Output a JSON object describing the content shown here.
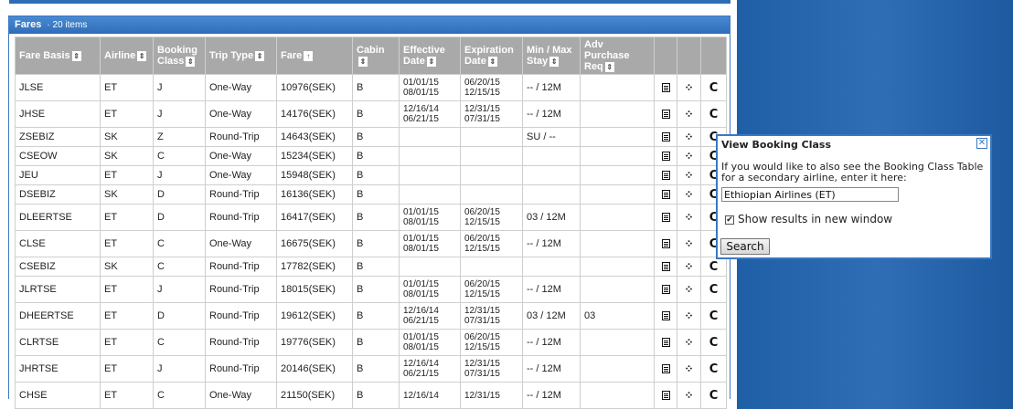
{
  "panel": {
    "title": "Fares",
    "count": "· 20 items"
  },
  "columns": [
    {
      "key": "fare_basis",
      "line1": "Fare Basis",
      "line2": "",
      "sort": "⇕"
    },
    {
      "key": "airline",
      "line1": "Airline",
      "line2": "",
      "sort": "⇕"
    },
    {
      "key": "booking_class",
      "line1": "Booking",
      "line2": "Class",
      "sort": "⇕"
    },
    {
      "key": "trip_type",
      "line1": "Trip Type",
      "line2": "",
      "sort": "⇕"
    },
    {
      "key": "fare",
      "line1": "Fare",
      "line2": "",
      "sort": "↑"
    },
    {
      "key": "cabin",
      "line1": "Cabin",
      "line2": "",
      "sort": "⇕"
    },
    {
      "key": "effective_date",
      "line1": "Effective",
      "line2": "Date",
      "sort": "⇕"
    },
    {
      "key": "expiration_date",
      "line1": "Expiration",
      "line2": "Date",
      "sort": "⇕"
    },
    {
      "key": "min_max_stay",
      "line1": "Min / Max",
      "line2": "Stay",
      "sort": "⇕"
    },
    {
      "key": "adv_purchase",
      "line1": "Adv Purchase",
      "line2": "Req",
      "sort": "⇕"
    }
  ],
  "row_icons": {
    "rules": "rules-icon",
    "route": "route-map-icon",
    "class": "booking-class-icon",
    "class_glyph": "C"
  },
  "rows": [
    {
      "fare_basis": "JLSE",
      "airline": "ET",
      "booking_class": "J",
      "trip_type": "One-Way",
      "fare": "10976(SEK)",
      "cabin": "B",
      "eff1": "01/01/15",
      "eff2": "08/01/15",
      "exp1": "06/20/15",
      "exp2": "12/15/15",
      "stay": "-- / 12M",
      "adv": ""
    },
    {
      "fare_basis": "JHSE",
      "airline": "ET",
      "booking_class": "J",
      "trip_type": "One-Way",
      "fare": "14176(SEK)",
      "cabin": "B",
      "eff1": "12/16/14",
      "eff2": "06/21/15",
      "exp1": "12/31/15",
      "exp2": "07/31/15",
      "stay": "-- / 12M",
      "adv": ""
    },
    {
      "fare_basis": "ZSEBIZ",
      "airline": "SK",
      "booking_class": "Z",
      "trip_type": "Round-Trip",
      "fare": "14643(SEK)",
      "cabin": "B",
      "eff1": "",
      "eff2": "",
      "exp1": "",
      "exp2": "",
      "stay": "SU / --",
      "adv": ""
    },
    {
      "fare_basis": "CSEOW",
      "airline": "SK",
      "booking_class": "C",
      "trip_type": "One-Way",
      "fare": "15234(SEK)",
      "cabin": "B",
      "eff1": "",
      "eff2": "",
      "exp1": "",
      "exp2": "",
      "stay": "",
      "adv": ""
    },
    {
      "fare_basis": "JEU",
      "airline": "ET",
      "booking_class": "J",
      "trip_type": "One-Way",
      "fare": "15948(SEK)",
      "cabin": "B",
      "eff1": "",
      "eff2": "",
      "exp1": "",
      "exp2": "",
      "stay": "",
      "adv": ""
    },
    {
      "fare_basis": "DSEBIZ",
      "airline": "SK",
      "booking_class": "D",
      "trip_type": "Round-Trip",
      "fare": "16136(SEK)",
      "cabin": "B",
      "eff1": "",
      "eff2": "",
      "exp1": "",
      "exp2": "",
      "stay": "",
      "adv": ""
    },
    {
      "fare_basis": "DLEERTSE",
      "airline": "ET",
      "booking_class": "D",
      "trip_type": "Round-Trip",
      "fare": "16417(SEK)",
      "cabin": "B",
      "eff1": "01/01/15",
      "eff2": "08/01/15",
      "exp1": "06/20/15",
      "exp2": "12/15/15",
      "stay": "03 / 12M",
      "adv": ""
    },
    {
      "fare_basis": "CLSE",
      "airline": "ET",
      "booking_class": "C",
      "trip_type": "One-Way",
      "fare": "16675(SEK)",
      "cabin": "B",
      "eff1": "01/01/15",
      "eff2": "08/01/15",
      "exp1": "06/20/15",
      "exp2": "12/15/15",
      "stay": "-- / 12M",
      "adv": ""
    },
    {
      "fare_basis": "CSEBIZ",
      "airline": "SK",
      "booking_class": "C",
      "trip_type": "Round-Trip",
      "fare": "17782(SEK)",
      "cabin": "B",
      "eff1": "",
      "eff2": "",
      "exp1": "",
      "exp2": "",
      "stay": "",
      "adv": ""
    },
    {
      "fare_basis": "JLRTSE",
      "airline": "ET",
      "booking_class": "J",
      "trip_type": "Round-Trip",
      "fare": "18015(SEK)",
      "cabin": "B",
      "eff1": "01/01/15",
      "eff2": "08/01/15",
      "exp1": "06/20/15",
      "exp2": "12/15/15",
      "stay": "-- / 12M",
      "adv": ""
    },
    {
      "fare_basis": "DHEERTSE",
      "airline": "ET",
      "booking_class": "D",
      "trip_type": "Round-Trip",
      "fare": "19612(SEK)",
      "cabin": "B",
      "eff1": "12/16/14",
      "eff2": "06/21/15",
      "exp1": "12/31/15",
      "exp2": "07/31/15",
      "stay": "03 / 12M",
      "adv": "03"
    },
    {
      "fare_basis": "CLRTSE",
      "airline": "ET",
      "booking_class": "C",
      "trip_type": "Round-Trip",
      "fare": "19776(SEK)",
      "cabin": "B",
      "eff1": "01/01/15",
      "eff2": "08/01/15",
      "exp1": "06/20/15",
      "exp2": "12/15/15",
      "stay": "-- / 12M",
      "adv": ""
    },
    {
      "fare_basis": "JHRTSE",
      "airline": "ET",
      "booking_class": "J",
      "trip_type": "Round-Trip",
      "fare": "20146(SEK)",
      "cabin": "B",
      "eff1": "12/16/14",
      "eff2": "06/21/15",
      "exp1": "12/31/15",
      "exp2": "07/31/15",
      "stay": "-- / 12M",
      "adv": ""
    },
    {
      "fare_basis": "CHSE",
      "airline": "ET",
      "booking_class": "C",
      "trip_type": "One-Way",
      "fare": "21150(SEK)",
      "cabin": "B",
      "eff1": "12/16/14",
      "eff2": "",
      "exp1": "12/31/15",
      "exp2": "",
      "stay": "-- / 12M",
      "adv": ""
    }
  ],
  "popup": {
    "title": "View Booking Class",
    "close_glyph": "✕",
    "message": "If you would like to also see the Booking Class Table for a secondary airline, enter it here:",
    "input_value": "Ethiopian Airlines (ET)",
    "checkbox_label": "Show results in new window",
    "checkbox_checked": true,
    "check_glyph": "✔",
    "button_label": "Search"
  }
}
